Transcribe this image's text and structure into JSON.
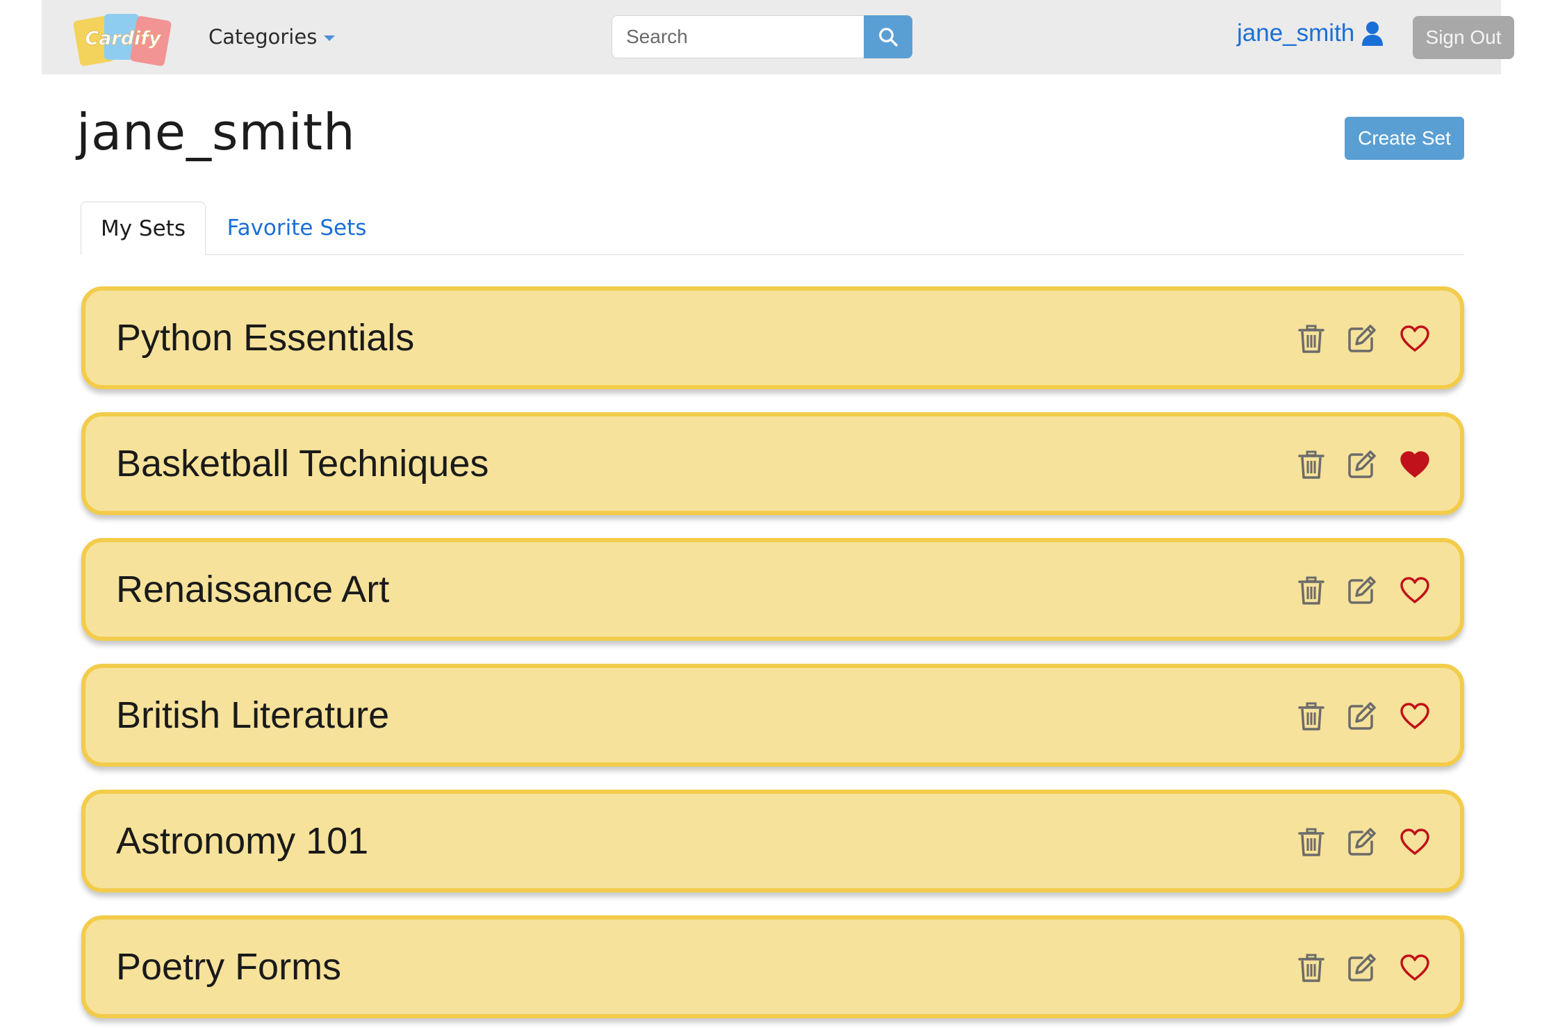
{
  "navbar": {
    "logo_text": "Cardify",
    "categories_label": "Categories",
    "search": {
      "placeholder": "Search",
      "value": ""
    },
    "username": "jane_smith",
    "signout_label": "Sign Out"
  },
  "page": {
    "title": "jane_smith",
    "create_label": "Create Set"
  },
  "tabs": [
    {
      "label": "My Sets",
      "active": true
    },
    {
      "label": "Favorite Sets",
      "active": false
    }
  ],
  "sets": [
    {
      "title": "Python Essentials",
      "favorited": false
    },
    {
      "title": "Basketball Techniques",
      "favorited": true
    },
    {
      "title": "Renaissance Art",
      "favorited": false
    },
    {
      "title": "British Literature",
      "favorited": false
    },
    {
      "title": "Astronomy 101",
      "favorited": false
    },
    {
      "title": "Poetry Forms",
      "favorited": false
    }
  ],
  "colors": {
    "card_bg": "#f6e29a",
    "card_border": "#f2cc4a",
    "heart": "#c0121a",
    "link": "#1a6fd6",
    "primary_button": "#5a9fd4"
  },
  "icons": [
    "search-icon",
    "user-icon",
    "trash-icon",
    "edit-icon",
    "heart-icon"
  ]
}
